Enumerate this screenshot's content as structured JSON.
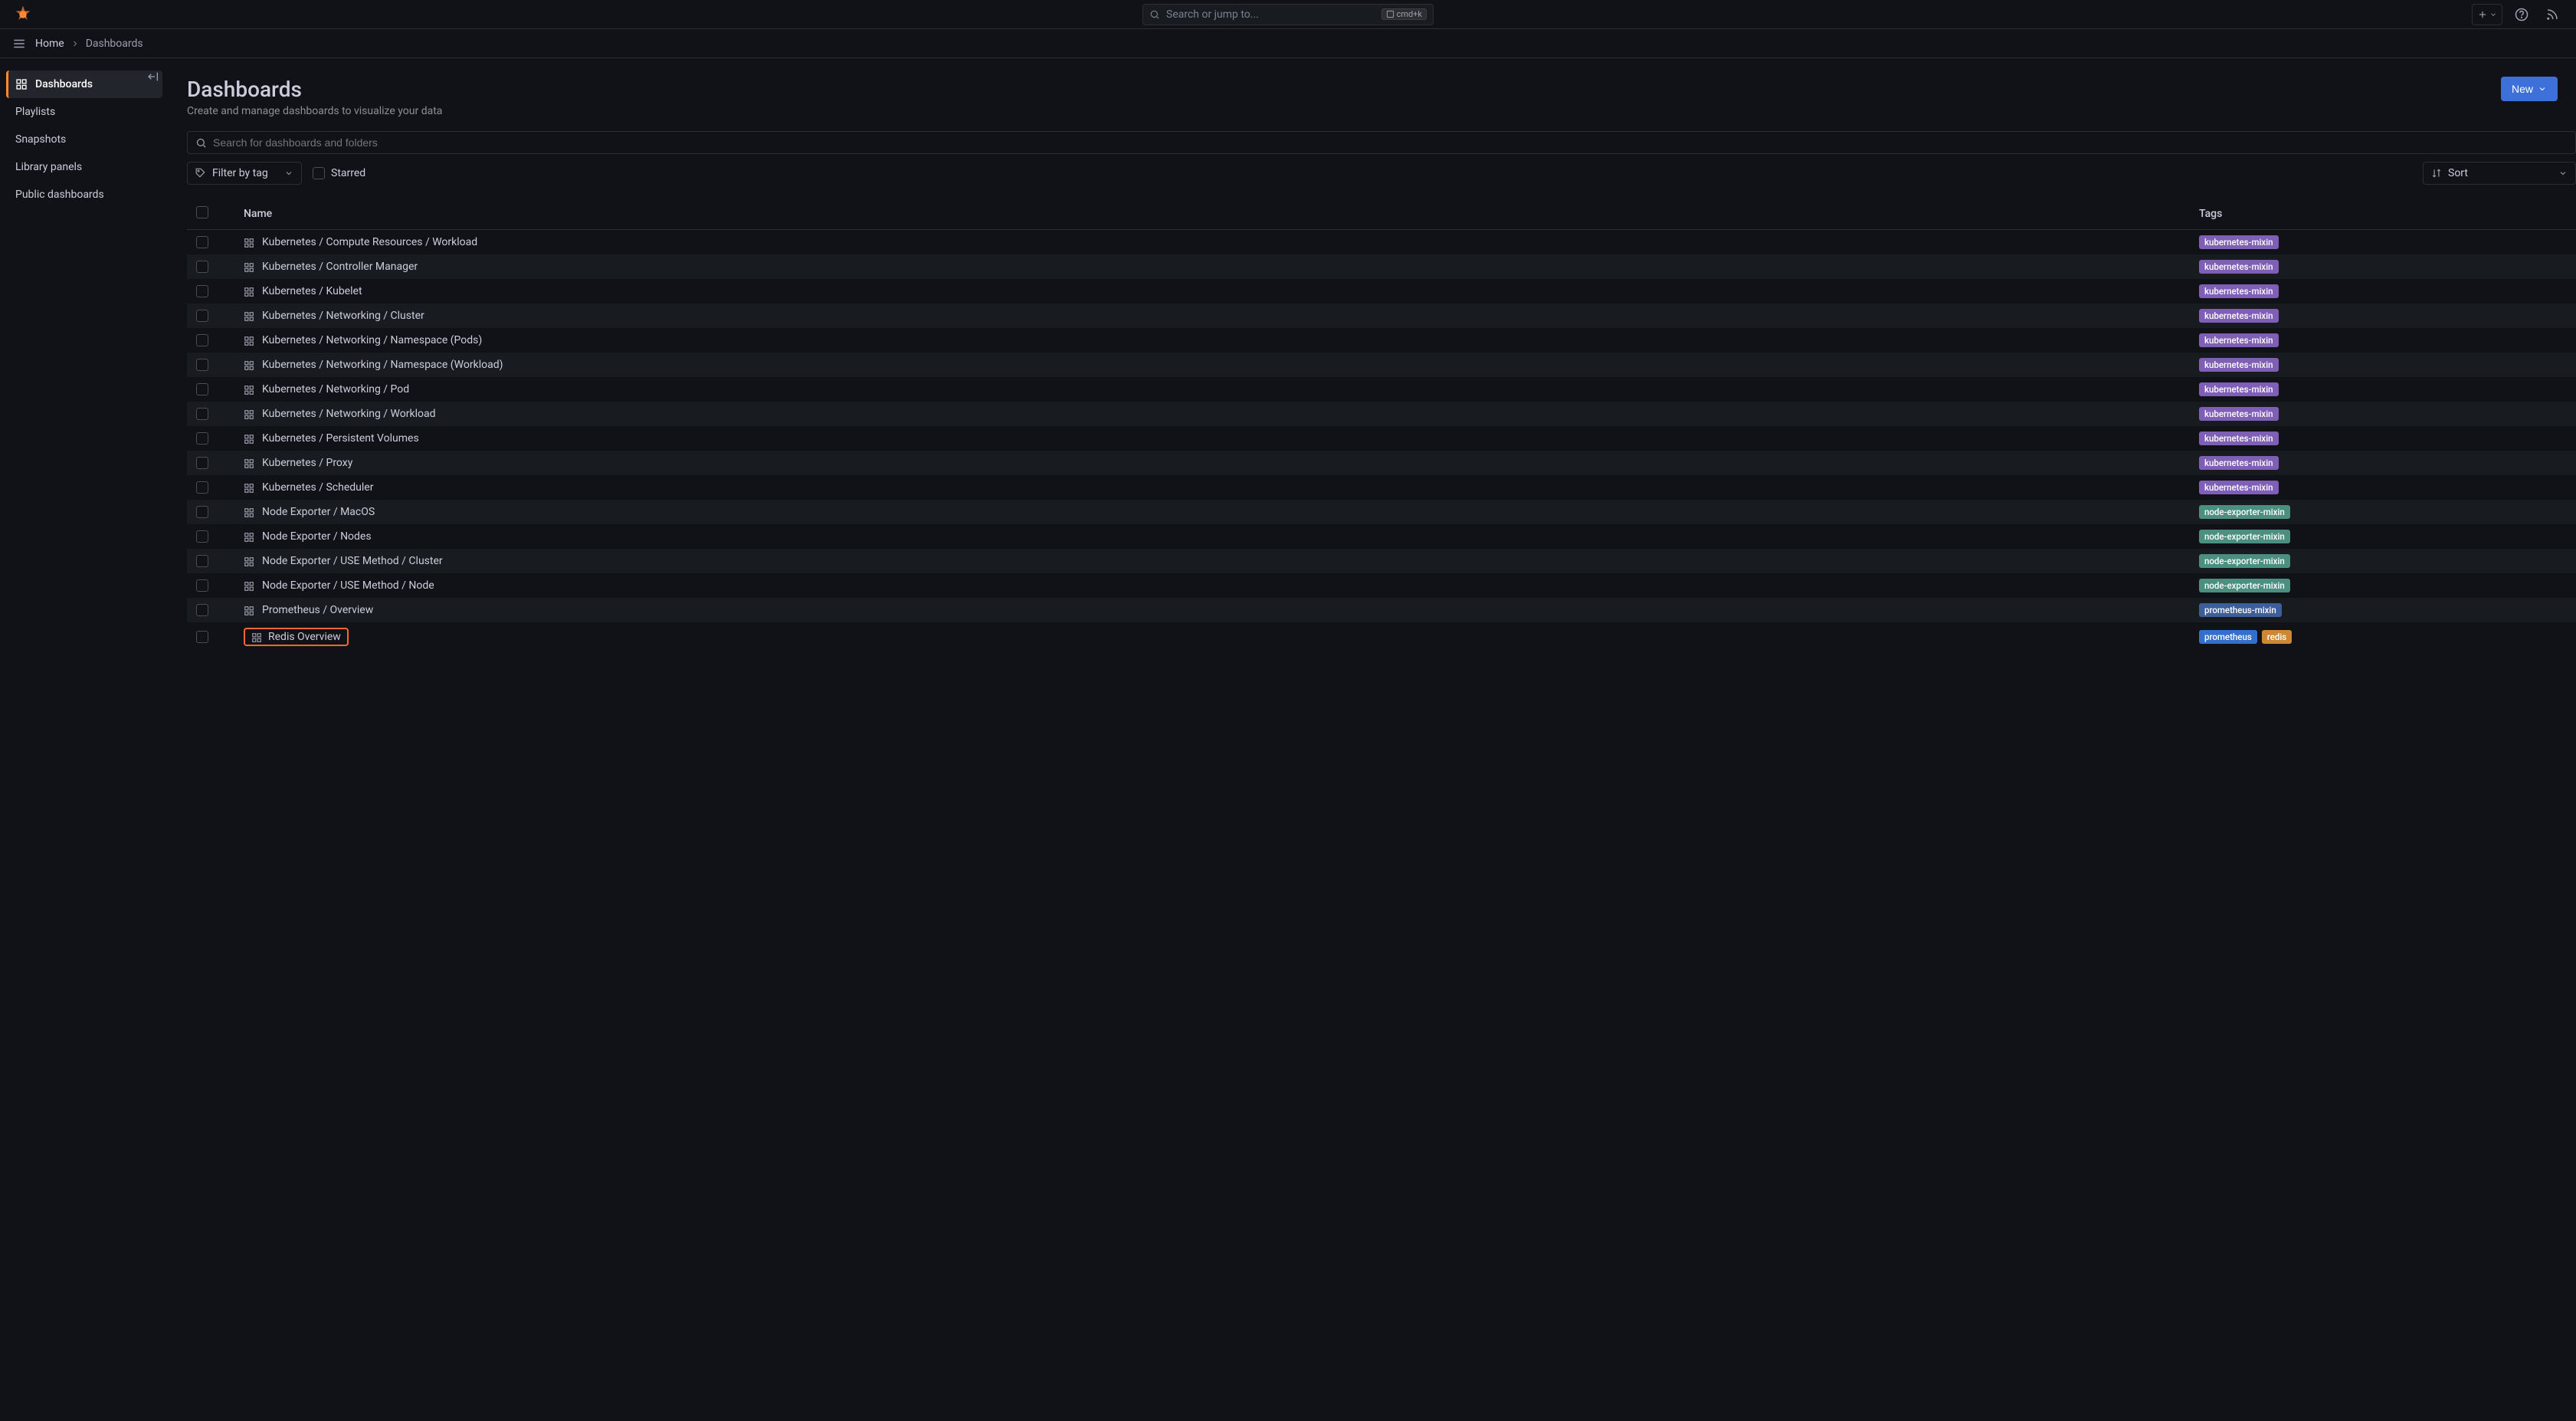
{
  "topbar": {
    "search_placeholder": "Search or jump to...",
    "kbd_hint": "cmd+k"
  },
  "breadcrumb": {
    "home": "Home",
    "current": "Dashboards"
  },
  "sidebar": {
    "items": [
      {
        "label": "Dashboards",
        "icon": "dashboard-icon",
        "active": true
      },
      {
        "label": "Playlists",
        "icon": "",
        "active": false
      },
      {
        "label": "Snapshots",
        "icon": "",
        "active": false
      },
      {
        "label": "Library panels",
        "icon": "",
        "active": false
      },
      {
        "label": "Public dashboards",
        "icon": "",
        "active": false
      }
    ]
  },
  "page": {
    "title": "Dashboards",
    "subtitle": "Create and manage dashboards to visualize your data",
    "new_button": "New",
    "search_placeholder": "Search for dashboards and folders",
    "filter_tag_label": "Filter by tag",
    "starred_label": "Starred",
    "sort_label": "Sort"
  },
  "table": {
    "headers": {
      "name": "Name",
      "tags": "Tags"
    },
    "rows": [
      {
        "name": "Kubernetes / Compute Resources / Workload",
        "tags": [
          "kubernetes-mixin"
        ],
        "highlighted": false
      },
      {
        "name": "Kubernetes / Controller Manager",
        "tags": [
          "kubernetes-mixin"
        ],
        "highlighted": false
      },
      {
        "name": "Kubernetes / Kubelet",
        "tags": [
          "kubernetes-mixin"
        ],
        "highlighted": false
      },
      {
        "name": "Kubernetes / Networking / Cluster",
        "tags": [
          "kubernetes-mixin"
        ],
        "highlighted": false
      },
      {
        "name": "Kubernetes / Networking / Namespace (Pods)",
        "tags": [
          "kubernetes-mixin"
        ],
        "highlighted": false
      },
      {
        "name": "Kubernetes / Networking / Namespace (Workload)",
        "tags": [
          "kubernetes-mixin"
        ],
        "highlighted": false
      },
      {
        "name": "Kubernetes / Networking / Pod",
        "tags": [
          "kubernetes-mixin"
        ],
        "highlighted": false
      },
      {
        "name": "Kubernetes / Networking / Workload",
        "tags": [
          "kubernetes-mixin"
        ],
        "highlighted": false
      },
      {
        "name": "Kubernetes / Persistent Volumes",
        "tags": [
          "kubernetes-mixin"
        ],
        "highlighted": false
      },
      {
        "name": "Kubernetes / Proxy",
        "tags": [
          "kubernetes-mixin"
        ],
        "highlighted": false
      },
      {
        "name": "Kubernetes / Scheduler",
        "tags": [
          "kubernetes-mixin"
        ],
        "highlighted": false
      },
      {
        "name": "Node Exporter / MacOS",
        "tags": [
          "node-exporter-mixin"
        ],
        "highlighted": false
      },
      {
        "name": "Node Exporter / Nodes",
        "tags": [
          "node-exporter-mixin"
        ],
        "highlighted": false
      },
      {
        "name": "Node Exporter / USE Method / Cluster",
        "tags": [
          "node-exporter-mixin"
        ],
        "highlighted": false
      },
      {
        "name": "Node Exporter / USE Method / Node",
        "tags": [
          "node-exporter-mixin"
        ],
        "highlighted": false
      },
      {
        "name": "Prometheus / Overview",
        "tags": [
          "prometheus-mixin"
        ],
        "highlighted": false
      },
      {
        "name": "Redis Overview",
        "tags": [
          "prometheus",
          "redis"
        ],
        "highlighted": true
      }
    ]
  }
}
